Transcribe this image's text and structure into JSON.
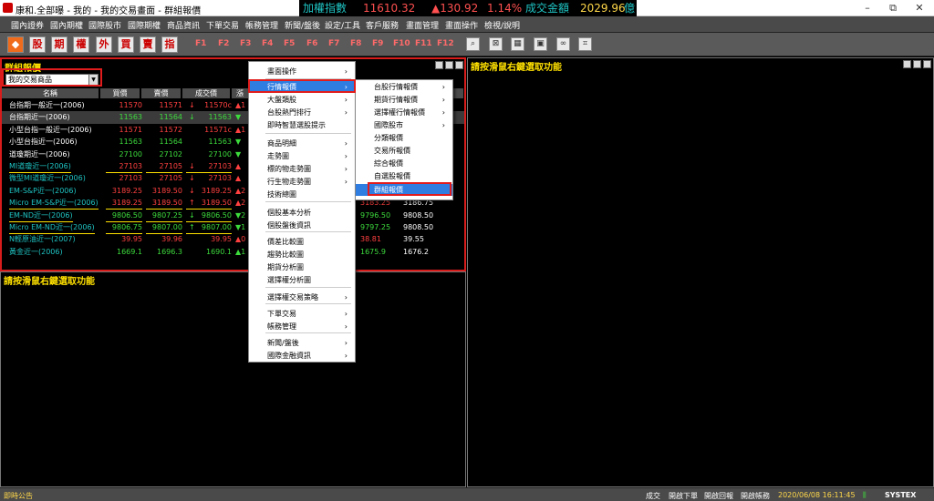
{
  "window": {
    "title": "康和.全部曝 - 我的 - 我的交易畫面 - 群組報價",
    "min_label": "–",
    "max_label": "⧉",
    "close_label": "✕"
  },
  "ticker": {
    "name": "加權指數",
    "index": "11610.32",
    "change": "▲130.92",
    "pct": "1.14%",
    "vol_label": "成交金額",
    "vol": "2029.96",
    "unit": "億"
  },
  "menu": [
    "國內證券",
    "國內期權",
    "國際股市",
    "國際期權",
    "商品資訊",
    "下單交易",
    "帳務管理",
    "新聞/盤後",
    "設定/工具",
    "客戶服務",
    "畫面管理",
    "畫面操作",
    "檢視/說明"
  ],
  "toolbar": {
    "quick": [
      "股",
      "期",
      "權",
      "外",
      "買",
      "賣",
      "指"
    ],
    "fkeys": [
      "F1",
      "F2",
      "F3",
      "F4",
      "F5",
      "F6",
      "F7",
      "F8",
      "F9",
      "F10",
      "F11",
      "F12"
    ],
    "tools": [
      "search-icon",
      "window-x-icon",
      "grid-icon",
      "tile-icon",
      "link-icon",
      "crop-icon"
    ]
  },
  "panel_main": {
    "title": "群組報價",
    "combo_value": "我的交易商品",
    "headers": [
      "名稱",
      "買價",
      "賣價",
      "成交價",
      "漲"
    ]
  },
  "rows": [
    {
      "name": "台指期一般近一(2006)",
      "bid": "11570",
      "ask": "11571",
      "dir": "↓",
      "last": "11570c",
      "chg": "▲1",
      "nc": "#ffffff",
      "pc": "#ff4040",
      "hl": false,
      "ul": false,
      "r_bid": "",
      "r_ask": ""
    },
    {
      "name": "台指期近一(2006)",
      "bid": "11563",
      "ask": "11564",
      "dir": "↓",
      "last": "11563",
      "chg": "▼",
      "nc": "#ffffff",
      "pc": "#3ddc3d",
      "hl": true,
      "ul": false,
      "r_bid": "",
      "r_ask": ""
    },
    {
      "name": "小型台指一般近一(2006)",
      "bid": "11571",
      "ask": "11572",
      "dir": "",
      "last": "11571c",
      "chg": "▲1",
      "nc": "#ffffff",
      "pc": "#ff4040",
      "hl": false,
      "ul": false,
      "r_bid": "",
      "r_ask": ""
    },
    {
      "name": "小型台指近一(2006)",
      "bid": "11563",
      "ask": "11564",
      "dir": "",
      "last": "11563",
      "chg": "▼",
      "nc": "#ffffff",
      "pc": "#3ddc3d",
      "hl": false,
      "ul": false,
      "r_bid": "",
      "r_ask": ""
    },
    {
      "name": "道瓊期近一(2006)",
      "bid": "27100",
      "ask": "27102",
      "dir": "",
      "last": "27100",
      "chg": "▼",
      "nc": "#ffffff",
      "pc": "#3ddc3d",
      "hl": false,
      "ul": false,
      "r_bid": "",
      "r_ask": ""
    },
    {
      "name": "MI道瓊近一(2006)",
      "bid": "27103",
      "ask": "27105",
      "dir": "↓",
      "last": "27103",
      "chg": "▲",
      "nc": "#1fc3c3",
      "pc": "#ff4040",
      "hl": false,
      "ul": true,
      "r_bid": "",
      "r_ask": ""
    },
    {
      "name": "微型MI道瓊近一(2006)",
      "bid": "27103",
      "ask": "27105",
      "dir": "↓",
      "last": "27103",
      "chg": "▲",
      "nc": "#1fc3c3",
      "pc": "#ff4040",
      "hl": false,
      "ul": false,
      "r_bid": "",
      "r_ask": ""
    },
    {
      "name": "EM-S&P近一(2006)",
      "bid": "3189.25",
      "ask": "3189.50",
      "dir": "↓",
      "last": "3189.25",
      "chg": "▲2",
      "nc": "#1fc3c3",
      "pc": "#ff4040",
      "hl": false,
      "ul": false,
      "r_bid": "3183.25",
      "r_ask": "3186.75"
    },
    {
      "name": "Micro EM-S&P近一(2006)",
      "bid": "3189.25",
      "ask": "3189.50",
      "dir": "↑",
      "last": "3189.50",
      "chg": "▲2",
      "nc": "#1fc3c3",
      "pc": "#ff4040",
      "hl": false,
      "ul": true,
      "r_bid": "3183.25",
      "r_ask": "3186.75"
    },
    {
      "name": "EM-ND近一(2006)",
      "bid": "9806.50",
      "ask": "9807.25",
      "dir": "↓",
      "last": "9806.50",
      "chg": "▼2",
      "nc": "#1fc3c3",
      "pc": "#3ddc3d",
      "hl": false,
      "ul": true,
      "r_bid": "9796.50",
      "r_ask": "9808.50"
    },
    {
      "name": "Micro EM-ND近一(2006)",
      "bid": "9806.75",
      "ask": "9807.00",
      "dir": "↑",
      "last": "9807.00",
      "chg": "▼1",
      "nc": "#1fc3c3",
      "pc": "#3ddc3d",
      "hl": false,
      "ul": true,
      "r_bid": "9797.25",
      "r_ask": "9808.50"
    },
    {
      "name": "N輕原油近一(2007)",
      "bid": "39.95",
      "ask": "39.96",
      "dir": "",
      "last": "39.95",
      "chg": "▲0",
      "nc": "#1fc3c3",
      "pc": "#ff4040",
      "hl": false,
      "ul": false,
      "r_bid": "38.81",
      "r_ask": "39.55"
    },
    {
      "name": "黃金近一(2006)",
      "bid": "1669.1",
      "ask": "1696.3",
      "dir": "",
      "last": "1690.1",
      "chg": "▲1",
      "nc": "#1fc3c3",
      "pc": "#3ddc3d",
      "hl": false,
      "ul": false,
      "r_bid": "1675.9",
      "r_ask": "1676.2"
    }
  ],
  "empty_hint": "請按滑鼠右鍵選取功能",
  "context_menu": [
    {
      "label": "畫面操作",
      "sub": true
    },
    {
      "label": "行情報價",
      "sub": true,
      "hl": true
    },
    {
      "label": "大盤類股",
      "sub": true
    },
    {
      "label": "台股熱門排行",
      "sub": true
    },
    {
      "label": "即時智慧選股提示",
      "sub": false
    },
    {
      "label": "商品明細",
      "sub": true
    },
    {
      "label": "走勢圖",
      "sub": true
    },
    {
      "label": "標的物走勢圖",
      "sub": true
    },
    {
      "label": "行生物走勢圖",
      "sub": true
    },
    {
      "label": "技術總圖",
      "sub": false
    },
    {
      "label": "個股基本分析",
      "sub": false
    },
    {
      "label": "個股盤後資訊",
      "sub": false
    },
    {
      "label": "價差比較圖",
      "sub": false
    },
    {
      "label": "趨勢比較圖",
      "sub": false
    },
    {
      "label": "期貨分析圖",
      "sub": false
    },
    {
      "label": "選擇權分析圖",
      "sub": false
    },
    {
      "label": "選擇權交易策略",
      "sub": true
    },
    {
      "label": "下單交易",
      "sub": true
    },
    {
      "label": "帳務管理",
      "sub": true
    },
    {
      "label": "新聞/盤後",
      "sub": true
    },
    {
      "label": "國際金融資訊",
      "sub": true
    }
  ],
  "submenu": [
    {
      "label": "台股行情報價",
      "sub": true
    },
    {
      "label": "期貨行情報價",
      "sub": true
    },
    {
      "label": "選擇權行情報價",
      "sub": true
    },
    {
      "label": "國際股市",
      "sub": true
    },
    {
      "label": "分類報價",
      "sub": false
    },
    {
      "label": "交易所報價",
      "sub": false
    },
    {
      "label": "綜合報價",
      "sub": false
    },
    {
      "label": "自選股報價",
      "sub": false
    },
    {
      "label": "群組報價",
      "sub": false,
      "hl": true
    }
  ],
  "status": {
    "left": "即時公告",
    "items": [
      "成交",
      "開啟下單",
      "開啟回報",
      "開啟帳務"
    ],
    "datetime": "2020/06/08 16:11:45",
    "brand": "SYSTEX"
  }
}
